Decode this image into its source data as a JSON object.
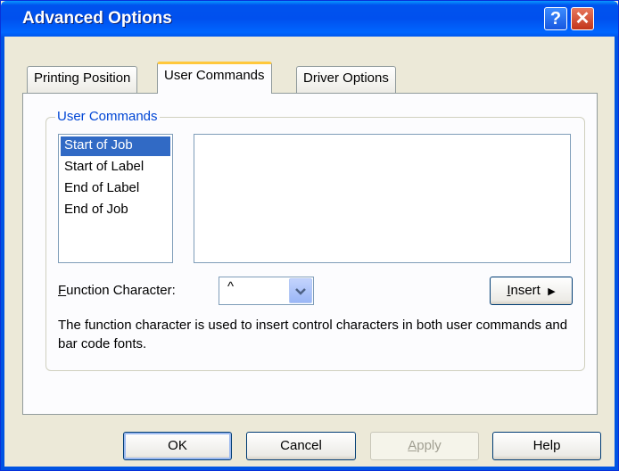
{
  "window": {
    "title": "Advanced Options",
    "help_glyph": "?",
    "close_glyph": "✕"
  },
  "tabs": [
    {
      "label": "Printing Position",
      "active": false
    },
    {
      "label": "User Commands",
      "active": true
    },
    {
      "label": "Driver Options",
      "active": false
    }
  ],
  "group": {
    "legend": "User Commands"
  },
  "commands_list": [
    {
      "label": "Start of Job",
      "selected": true
    },
    {
      "label": "Start of Label",
      "selected": false
    },
    {
      "label": "End of Label",
      "selected": false
    },
    {
      "label": "End of Job",
      "selected": false
    }
  ],
  "command_text": "",
  "function_character": {
    "label_access": "F",
    "label_rest": "unction Character:",
    "value": "^",
    "arrow_icon": "chevron-down-icon"
  },
  "insert_button": {
    "label_access": "I",
    "label_rest": "nsert",
    "arrow": "▶"
  },
  "description": "The function character is used to insert control characters in both user commands and bar code fonts.",
  "buttons": {
    "ok": "OK",
    "cancel": "Cancel",
    "apply_access": "A",
    "apply_rest": "pply",
    "help": "Help"
  },
  "colors": {
    "titlebar": "#0054e3",
    "selection": "#316ac5",
    "group_legend": "#0046d5",
    "tab_highlight": "#ffc83c"
  }
}
